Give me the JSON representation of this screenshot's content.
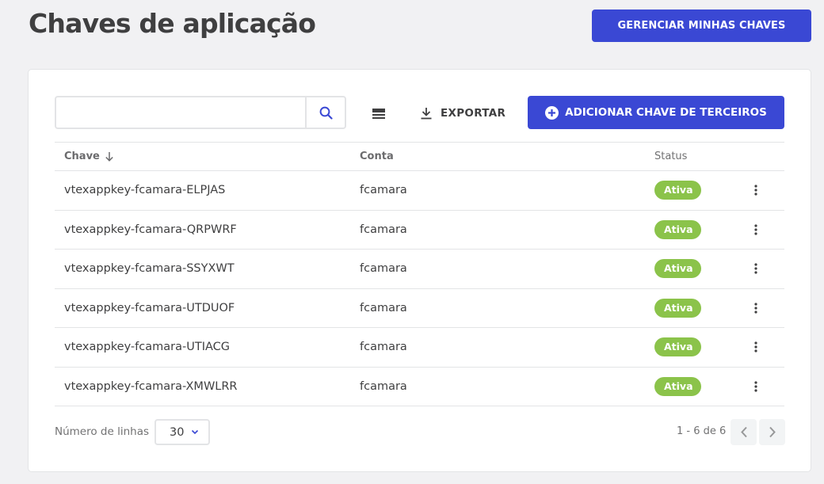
{
  "header": {
    "title": "Chaves de aplicação",
    "manage_button": "GERENCIAR MINHAS CHAVES"
  },
  "toolbar": {
    "search_value": "",
    "search_placeholder": "",
    "export_label": "EXPORTAR",
    "add_button": "ADICIONAR CHAVE DE TERCEIROS"
  },
  "table": {
    "columns": {
      "key": "Chave",
      "account": "Conta",
      "status": "Status"
    },
    "sort": {
      "column": "key",
      "direction": "descending"
    },
    "rows": [
      {
        "key": "vtexappkey-fcamara-ELPJAS",
        "account": "fcamara",
        "status": "Ativa"
      },
      {
        "key": "vtexappkey-fcamara-QRPWRF",
        "account": "fcamara",
        "status": "Ativa"
      },
      {
        "key": "vtexappkey-fcamara-SSYXWT",
        "account": "fcamara",
        "status": "Ativa"
      },
      {
        "key": "vtexappkey-fcamara-UTDUOF",
        "account": "fcamara",
        "status": "Ativa"
      },
      {
        "key": "vtexappkey-fcamara-UTIACG",
        "account": "fcamara",
        "status": "Ativa"
      },
      {
        "key": "vtexappkey-fcamara-XMWLRR",
        "account": "fcamara",
        "status": "Ativa"
      }
    ]
  },
  "footer": {
    "rows_label": "Número de linhas",
    "rows_value": "30",
    "page_info": "1 - 6 de 6"
  },
  "colors": {
    "primary": "#3a48d4",
    "status_active": "#8bc34a",
    "background": "#f1f1f3"
  },
  "icons": {
    "search": "search-icon",
    "density": "density-icon",
    "export": "download-icon",
    "add": "plus-circle-icon",
    "sort": "arrow-down-icon",
    "menu": "kebab-icon",
    "select": "chevron-down-icon",
    "prev": "chevron-left-icon",
    "next": "chevron-right-icon"
  }
}
